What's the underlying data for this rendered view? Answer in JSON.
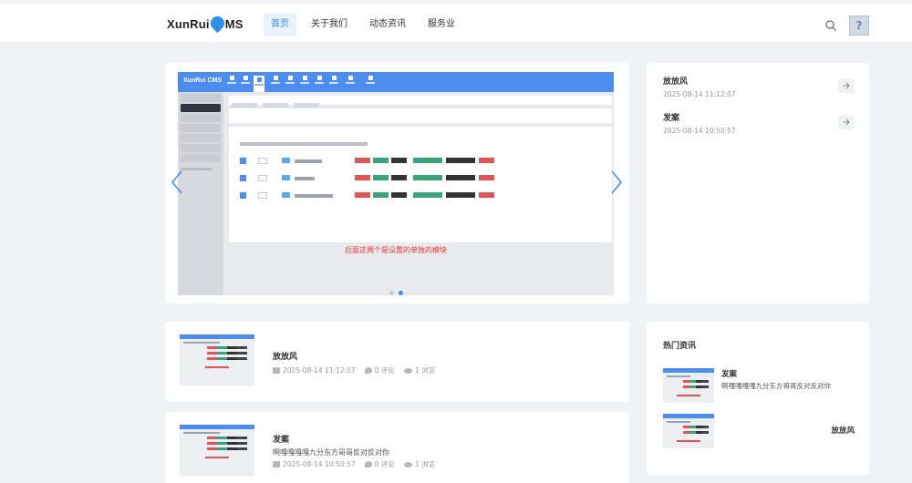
{
  "header": {
    "logo_a": "XunRui",
    "logo_b": "MS",
    "nav": [
      {
        "label": "首页",
        "active": true
      },
      {
        "label": "关于我们",
        "active": false
      },
      {
        "label": "动态资讯",
        "active": false
      },
      {
        "label": "服务业",
        "active": false
      }
    ],
    "search_icon": "search-icon",
    "avatar_icon": "avatar-placeholder-icon"
  },
  "slider": {
    "caption": "后面这两个是设置的单独的模块",
    "inner_logo": "XunRui CMS",
    "slides_count": 2,
    "active_slide": 2,
    "prev_icon": "chevron-left-icon",
    "next_icon": "chevron-right-icon"
  },
  "news": [
    {
      "title": "放放风",
      "date": "2025-08-14 11:12:07"
    },
    {
      "title": "发案",
      "date": "2025-08-14 10:50:57"
    }
  ],
  "posts": [
    {
      "title": "放放风",
      "desc": "",
      "date": "2025-08-14 11:12:07",
      "comments": "0 评论",
      "views": "1 浏览"
    },
    {
      "title": "发案",
      "desc": "啊嘎嘎嘎嘎九分东方哥哥反对反对你",
      "date": "2025-08-14 10:50:57",
      "comments": "0 评论",
      "views": "1 浏览"
    }
  ],
  "hot": {
    "heading": "热门资讯",
    "items": [
      {
        "title": "发案",
        "desc": "啊嘎嘎嘎嘎九分东方哥哥反对反对你"
      },
      {
        "title": "放放风",
        "desc": ""
      }
    ]
  },
  "colors": {
    "accent": "#2a8fe6",
    "caption_red": "#e53935"
  }
}
